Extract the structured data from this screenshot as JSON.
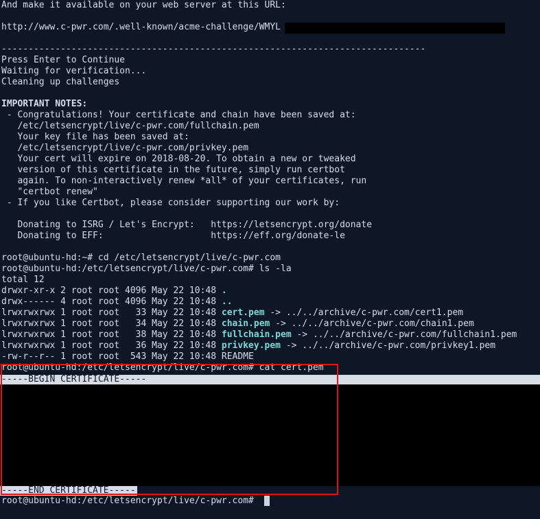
{
  "lines": {
    "l1": "And make it available on your web server at this URL:",
    "l3": "http://www.c-pwr.com/.well-known/acme-challenge/WMYL",
    "l5": "-------------------------------------------------------------------------------",
    "l6": "Press Enter to Continue",
    "l7": "Waiting for verification...",
    "l8": "Cleaning up challenges",
    "l10": "IMPORTANT NOTES:",
    "l11": " - Congratulations! Your certificate and chain have been saved at:",
    "l12": "   /etc/letsencrypt/live/c-pwr.com/fullchain.pem",
    "l13": "   Your key file has been saved at:",
    "l14": "   /etc/letsencrypt/live/c-pwr.com/privkey.pem",
    "l15": "   Your cert will expire on 2018-08-20. To obtain a new or tweaked",
    "l16": "   version of this certificate in the future, simply run certbot",
    "l17": "   again. To non-interactively renew *all* of your certificates, run",
    "l18": "   \"certbot renew\"",
    "l19": " - If you like Certbot, please consider supporting our work by:",
    "l21": "   Donating to ISRG / Let's Encrypt:   https://letsencrypt.org/donate",
    "l22": "   Donating to EFF:                    https://eff.org/donate-le",
    "l24": "root@ubuntu-hd:~# cd /etc/letsencrypt/live/c-pwr.com",
    "l25": "root@ubuntu-hd:/etc/letsencrypt/live/c-pwr.com# ls -la",
    "l26": "total 12"
  },
  "listing": [
    {
      "perm": "drwxr-xr-x 2 root root 4096 May 22 10:48 ",
      "name": ".",
      "target": ""
    },
    {
      "perm": "drwx------ 4 root root 4096 May 22 10:48 ",
      "name": "..",
      "target": ""
    },
    {
      "perm": "lrwxrwxrwx 1 root root   33 May 22 10:48 ",
      "name": "cert.pem",
      "target": " -> ../../archive/c-pwr.com/cert1.pem"
    },
    {
      "perm": "lrwxrwxrwx 1 root root   34 May 22 10:48 ",
      "name": "chain.pem",
      "target": " -> ../../archive/c-pwr.com/chain1.pem"
    },
    {
      "perm": "lrwxrwxrwx 1 root root   38 May 22 10:48 ",
      "name": "fullchain.pem",
      "target": " -> ../../archive/c-pwr.com/fullchain1.pem"
    },
    {
      "perm": "lrwxrwxrwx 1 root root   36 May 22 10:48 ",
      "name": "privkey.pem",
      "target": " -> ../../archive/c-pwr.com/privkey1.pem"
    },
    {
      "perm": "-rw-r--r-- 1 root root  543 May 22 10:48 ",
      "name": "",
      "target": "README"
    }
  ],
  "cat_command": "root@ubuntu-hd:/etc/letsencrypt/live/c-pwr.com# cat cert.pem",
  "begin_cert": "-----BEGIN CERTIFICATE-----",
  "end_cert": "-----END CERTIFICATE-----",
  "prompt": "root@ubuntu-hd:/etc/letsencrypt/live/c-pwr.com# ",
  "colors": {
    "background": "#0d1726",
    "foreground": "#d7dde7",
    "link_name": "#7fd8d6",
    "highlight_box": "#e0121b"
  }
}
